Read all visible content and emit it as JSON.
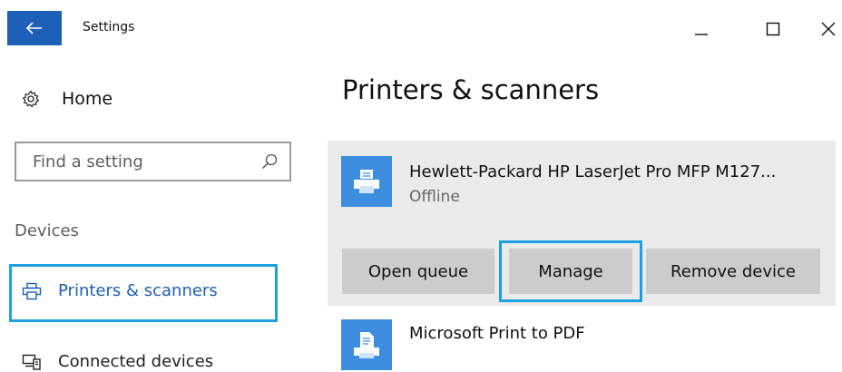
{
  "window": {
    "title": "Settings",
    "back_icon": "arrow-left-icon",
    "controls": [
      "minimize-icon",
      "maximize-icon",
      "close-icon"
    ]
  },
  "sidebar": {
    "home": {
      "label": "Home",
      "icon": "gear-icon"
    },
    "search": {
      "placeholder": "Find a setting",
      "value": "",
      "icon": "search-icon"
    },
    "section_label": "Devices",
    "items": [
      {
        "label": "Printers & scanners",
        "icon": "printer-icon",
        "selected": true
      },
      {
        "label": "Connected devices",
        "icon": "devices-icon",
        "selected": false
      }
    ]
  },
  "main": {
    "title": "Printers & scanners",
    "printers": [
      {
        "name": "Hewlett-Packard HP LaserJet Pro MFP M127...",
        "status": "Offline",
        "icon": "printer-icon",
        "expanded": true,
        "actions": [
          "Open queue",
          "Manage",
          "Remove device"
        ],
        "highlighted_action": "Manage"
      },
      {
        "name": "Microsoft Print to PDF",
        "icon": "pdf-printer-icon",
        "expanded": false
      }
    ]
  },
  "colors": {
    "accent": "#1e60b8",
    "highlight": "#1ea0e0",
    "selected_text": "#1f5fb0",
    "printer_icon_bg": "#3e8ee0",
    "card_bg": "#eaeaea",
    "button_bg": "#cccccc"
  }
}
